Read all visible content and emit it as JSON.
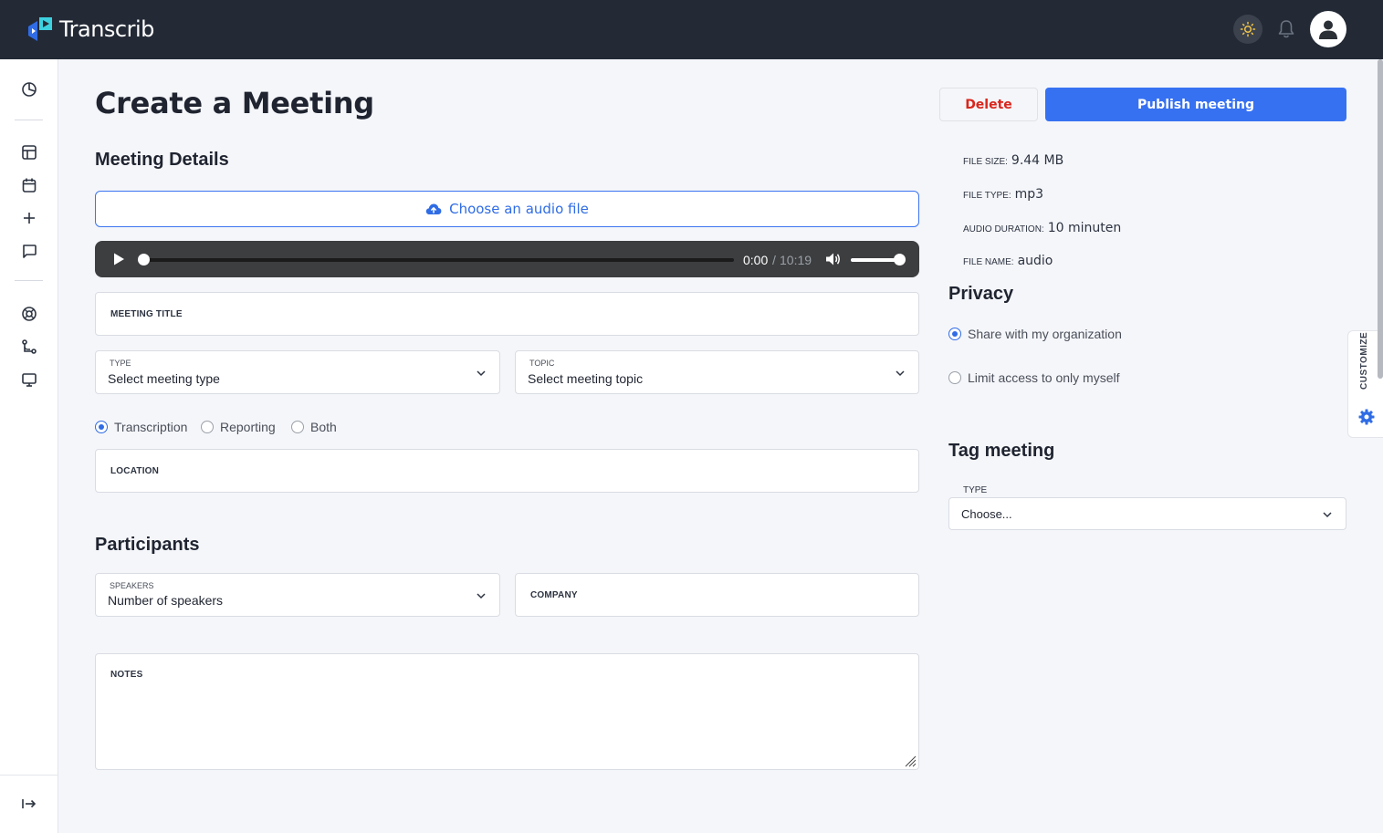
{
  "app": {
    "name": "Transcrib"
  },
  "colors": {
    "accent": "#3671f2",
    "danger": "#d9261c",
    "topbar": "#232a36"
  },
  "header": {
    "icons": [
      "sun-icon",
      "bell-icon",
      "user-icon"
    ]
  },
  "sidebar": {
    "items": [
      "dashboard-icon",
      "layout-icon",
      "calendar-icon",
      "plus-icon",
      "chat-icon",
      "help-icon",
      "workflow-icon",
      "monitor-icon"
    ],
    "collapse_icon": "expand-icon"
  },
  "page": {
    "title": "Create a Meeting",
    "delete_label": "Delete",
    "publish_label": "Publish meeting"
  },
  "details": {
    "title": "Meeting Details",
    "upload_label": "Choose an audio file",
    "player": {
      "current": "0:00",
      "separator": "/",
      "duration": "10:19",
      "progress": 0.0,
      "volume": 1.0
    },
    "meeting_title_label": "MEETING TITLE",
    "type": {
      "label": "TYPE",
      "value": "Select meeting type"
    },
    "topic": {
      "label": "TOPIC",
      "value": "Select meeting topic"
    },
    "mode_options": [
      {
        "label": "Transcription",
        "selected": true
      },
      {
        "label": "Reporting",
        "selected": false
      },
      {
        "label": "Both",
        "selected": false
      }
    ],
    "location_label": "LOCATION"
  },
  "participants": {
    "title": "Participants",
    "speakers": {
      "label": "SPEAKERS",
      "value": "Number of speakers"
    },
    "company_label": "COMPANY",
    "notes_label": "NOTES"
  },
  "file_info": [
    {
      "key": "FILE SIZE:",
      "value": "9.44 MB"
    },
    {
      "key": "FILE TYPE:",
      "value": "mp3"
    },
    {
      "key": "AUDIO DURATION:",
      "value": "10 minuten"
    },
    {
      "key": "FILE NAME:",
      "value": "audio"
    }
  ],
  "privacy": {
    "title": "Privacy",
    "options": [
      {
        "label": "Share with my organization",
        "selected": true
      },
      {
        "label": "Limit access to only myself",
        "selected": false
      }
    ]
  },
  "tag": {
    "title": "Tag meeting",
    "type_label": "TYPE",
    "type_value": "Choose..."
  },
  "customize": {
    "label": "CUSTOMIZE"
  }
}
